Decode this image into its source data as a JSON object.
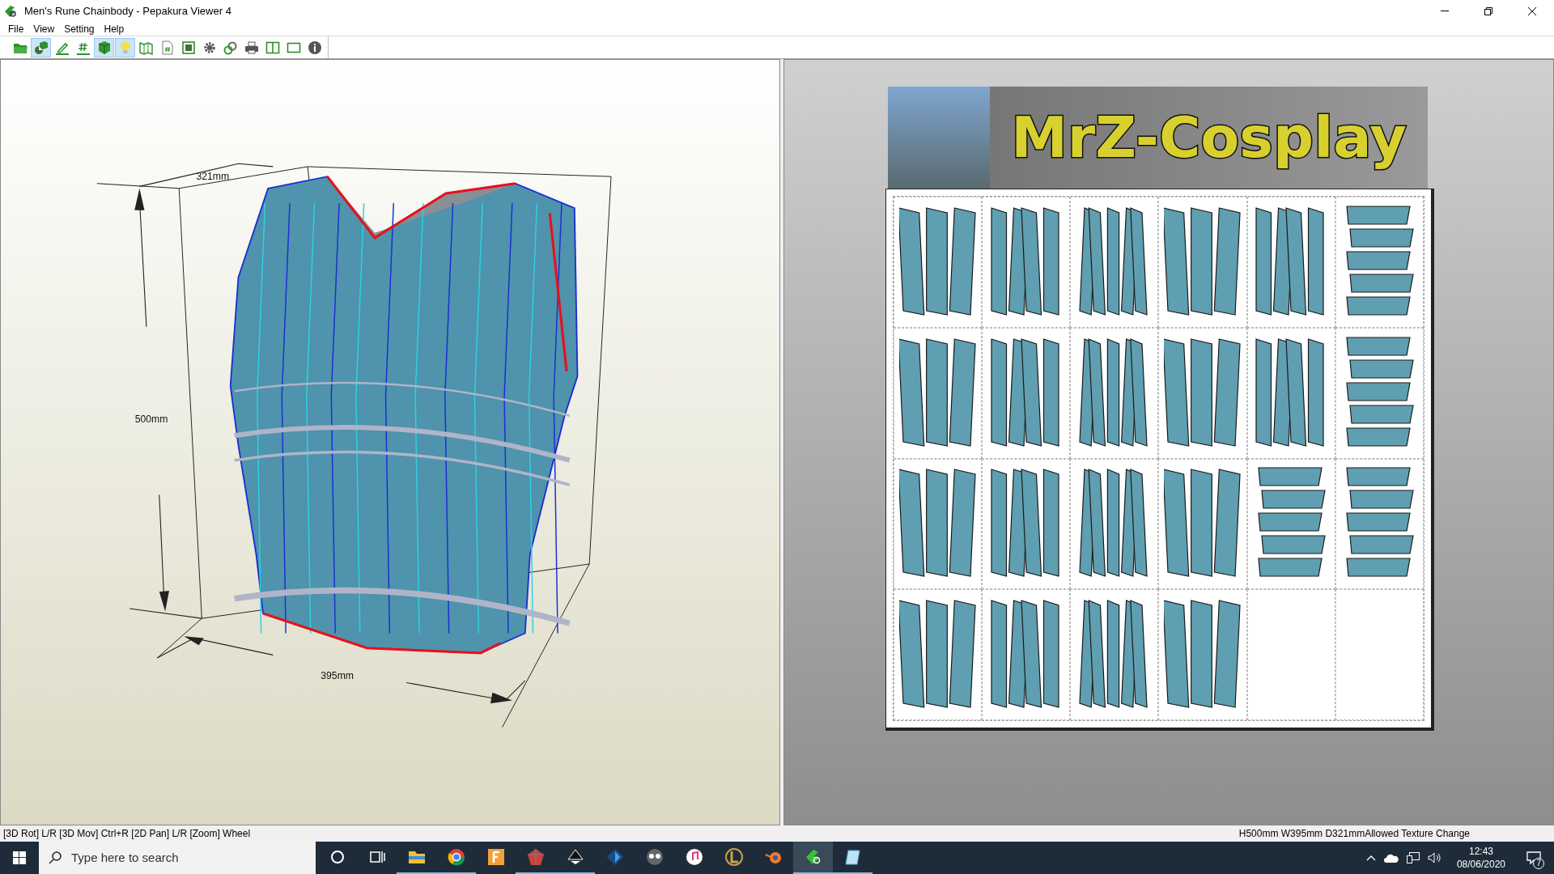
{
  "window": {
    "title": "Men's Rune Chainbody - Pepakura Viewer 4"
  },
  "menu": [
    "File",
    "View",
    "Setting",
    "Help"
  ],
  "toolbar": [
    {
      "pressed": false
    },
    {
      "pressed": true
    },
    {
      "pressed": false
    },
    {
      "pressed": false
    },
    {
      "pressed": true
    },
    {
      "pressed": true
    },
    {
      "pressed": false
    },
    {
      "pressed": false
    },
    {
      "pressed": false
    },
    {
      "pressed": false
    },
    {
      "pressed": false
    },
    {
      "pressed": false
    },
    {
      "pressed": false
    },
    {
      "pressed": false
    },
    {
      "pressed": false
    }
  ],
  "viewport_3d": {
    "dimensions": {
      "depth": "321mm",
      "height": "500mm",
      "width": "395mm"
    }
  },
  "pattern_view": {
    "banner": {
      "text": "MrZ-Cosplay"
    },
    "cells": [
      {
        "filled": true
      },
      {
        "filled": true
      },
      {
        "filled": true
      },
      {
        "filled": true
      },
      {
        "filled": true
      },
      {
        "filled": true
      },
      {
        "filled": true
      },
      {
        "filled": true
      },
      {
        "filled": true
      },
      {
        "filled": true
      },
      {
        "filled": true
      },
      {
        "filled": true
      },
      {
        "filled": true
      },
      {
        "filled": true
      },
      {
        "filled": true
      },
      {
        "filled": true
      },
      {
        "filled": true
      },
      {
        "filled": true
      },
      {
        "filled": true
      },
      {
        "filled": true
      },
      {
        "filled": true
      },
      {
        "filled": true
      },
      {
        "filled": false
      },
      {
        "filled": false
      }
    ]
  },
  "status_bar": {
    "hint": "[3D Rot] L/R [3D Mov] Ctrl+R [2D Pan] L/R [Zoom] Wheel",
    "info": "H500mm W395mm D321mmAllowed Texture Change"
  },
  "taskbar": {
    "search": {
      "placeholder": "Type here to search"
    },
    "apps": [
      {
        "running": false,
        "active": false
      },
      {
        "running": false,
        "active": false
      },
      {
        "running": true,
        "active": false
      },
      {
        "running": true,
        "active": false
      },
      {
        "running": false,
        "active": false
      },
      {
        "running": true,
        "active": false
      },
      {
        "running": true,
        "active": false
      },
      {
        "running": false,
        "active": false
      },
      {
        "running": false,
        "active": false
      },
      {
        "running": false,
        "active": false
      },
      {
        "running": false,
        "active": false
      },
      {
        "running": false,
        "active": false
      },
      {
        "running": true,
        "active": true
      },
      {
        "running": true,
        "active": false
      }
    ],
    "clock": {
      "time": "12:43",
      "date": "08/06/2020"
    },
    "notifications": "7"
  }
}
